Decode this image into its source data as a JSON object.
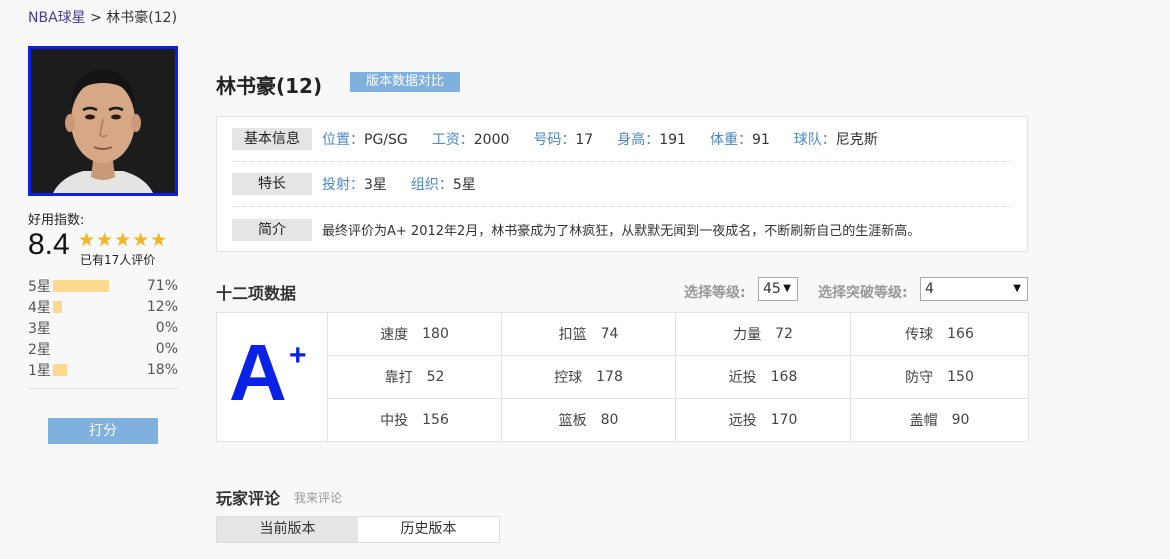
{
  "breadcrumb": {
    "root": "NBA球星",
    "sep": ">",
    "current": "林书豪(12)"
  },
  "player": {
    "name": "林书豪(12)",
    "compare_label": "版本数据对比"
  },
  "rating": {
    "title": "好用指数:",
    "score": "8.4",
    "stars": "★★★★★",
    "count_text": "已有17人评价",
    "distribution": [
      {
        "label": "5星",
        "pct_text": "71%",
        "pct": 71
      },
      {
        "label": "4星",
        "pct_text": "12%",
        "pct": 12
      },
      {
        "label": "3星",
        "pct_text": "0%",
        "pct": 0
      },
      {
        "label": "2星",
        "pct_text": "0%",
        "pct": 0
      },
      {
        "label": "1星",
        "pct_text": "18%",
        "pct": 18
      }
    ],
    "rate_button": "打分"
  },
  "info": {
    "basic_tag": "基本信息",
    "position_label": "位置：",
    "position": "PG/SG",
    "salary_label": "工资：",
    "salary": "2000",
    "number_label": "号码：",
    "number": "17",
    "height_label": "身高：",
    "height": "191",
    "weight_label": "体重：",
    "weight": "91",
    "team_label": "球队：",
    "team": "尼克斯",
    "specialty_tag": "特长",
    "shooting_label": "投射：",
    "shooting": "3星",
    "organize_label": "组织：",
    "organize": "5星",
    "intro_tag": "简介",
    "intro": "最终评价为A+ 2012年2月，林书豪成为了林疯狂，从默默无闻到一夜成名，不断刷新自己的生涯新高。"
  },
  "stats": {
    "title": "十二项数据",
    "level_label": "选择等级:",
    "level_value": "45",
    "break_label": "选择突破等级:",
    "break_value": "4",
    "grade": "A",
    "grade_suffix": "+",
    "items": [
      {
        "label": "速度",
        "value": "180"
      },
      {
        "label": "扣篮",
        "value": "74"
      },
      {
        "label": "力量",
        "value": "72"
      },
      {
        "label": "传球",
        "value": "166"
      },
      {
        "label": "靠打",
        "value": "52"
      },
      {
        "label": "控球",
        "value": "178"
      },
      {
        "label": "近投",
        "value": "168"
      },
      {
        "label": "防守",
        "value": "150"
      },
      {
        "label": "中投",
        "value": "156"
      },
      {
        "label": "篮板",
        "value": "80"
      },
      {
        "label": "远投",
        "value": "170"
      },
      {
        "label": "盖帽",
        "value": "90"
      }
    ]
  },
  "comments": {
    "title": "玩家评论",
    "write_link": "我来评论",
    "tab_current": "当前版本",
    "tab_history": "历史版本"
  },
  "colors": {
    "accent": "#7fb0de",
    "grade": "#0a22e6",
    "star": "#f6b322",
    "bar": "#fcd98f",
    "label_blue": "#4d88c4"
  }
}
